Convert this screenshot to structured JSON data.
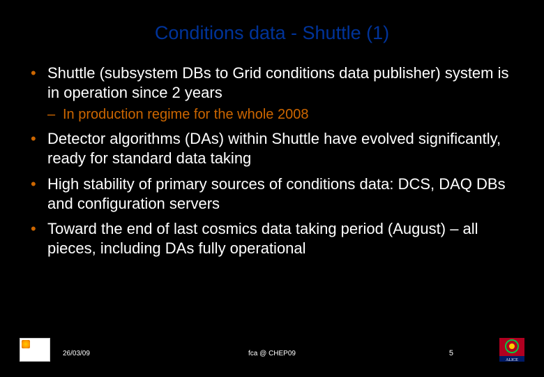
{
  "title": "Conditions data - Shuttle (1)",
  "bullets": {
    "b1": "Shuttle (subsystem DBs to Grid conditions data publisher) system is in operation since 2 years",
    "b1_sub1": "In production regime for the whole 2008",
    "b2": "Detector algorithms (DAs) within Shuttle have evolved significantly, ready for standard data taking",
    "b3": "High stability of primary sources of conditions data: DCS, DAQ DBs and configuration servers",
    "b4": "Toward the end of last cosmics data taking period (August) – all pieces, including DAs fully operational"
  },
  "footer": {
    "date": "26/03/09",
    "center": "fca @ CHEP09",
    "pagenum": "5"
  }
}
